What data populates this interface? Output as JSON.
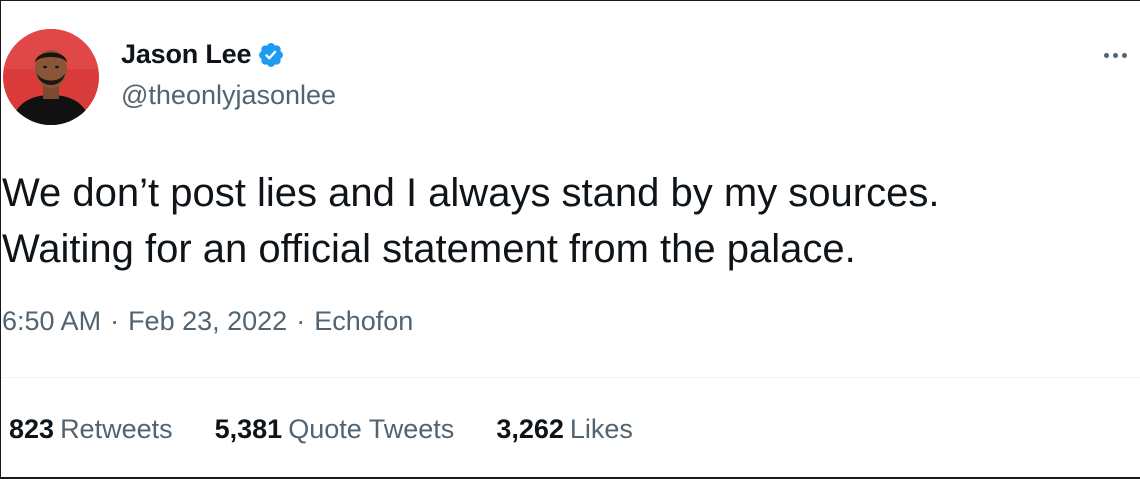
{
  "author": {
    "name": "Jason Lee",
    "handle": "@theonlyjasonlee",
    "verified": true,
    "avatar_bg": "#d93a3a"
  },
  "tweet": {
    "lines": [
      "We don’t post lies and I always stand by my sources.",
      "Waiting for an official statement from the palace."
    ],
    "time": "6:50 AM",
    "date": "Feb 23, 2022",
    "source": "Echofon",
    "separator": "·"
  },
  "stats": [
    {
      "count": "823",
      "label": "Retweets"
    },
    {
      "count": "5,381",
      "label": "Quote Tweets"
    },
    {
      "count": "3,262",
      "label": "Likes"
    }
  ],
  "icons": {
    "verified": "verified-badge-icon",
    "more": "more-options-icon"
  },
  "colors": {
    "verified_blue": "#1d9bf0",
    "secondary_text": "#536471",
    "primary_text": "#0f1419"
  }
}
